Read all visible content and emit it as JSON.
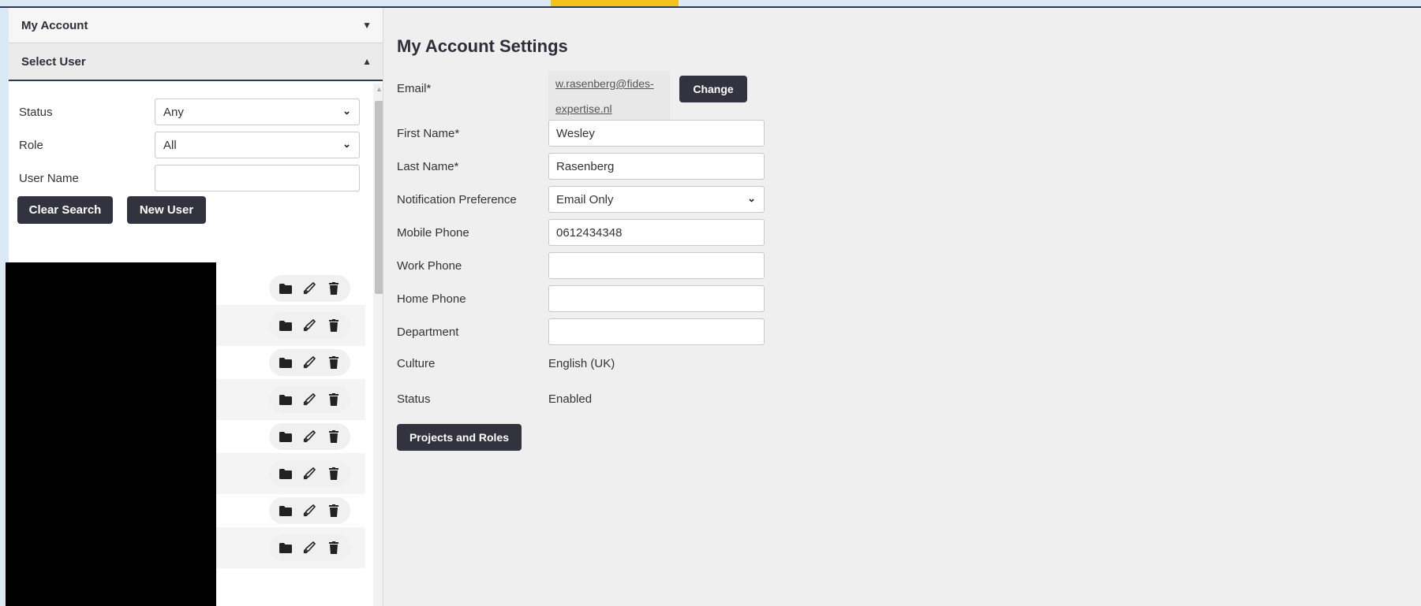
{
  "left_panel": {
    "my_account_header": "My Account",
    "select_user_header": "Select User",
    "filters": {
      "status_label": "Status",
      "status_value": "Any",
      "role_label": "Role",
      "role_value": "All",
      "username_label": "User Name",
      "username_value": ""
    },
    "buttons": {
      "clear_search": "Clear Search",
      "new_user": "New User"
    },
    "user_rows_count": 8,
    "row_action_icons": [
      "folder-icon",
      "edit-icon",
      "trash-icon"
    ]
  },
  "main": {
    "title": "My Account Settings",
    "email_label": "Email*",
    "email_value": "w.rasenberg@fides-expertise.nl",
    "email_line1": "w.rasenberg@fides-",
    "email_line2": "expertise.nl",
    "change_button": "Change",
    "first_name_label": "First Name*",
    "first_name_value": "Wesley",
    "last_name_label": "Last Name*",
    "last_name_value": "Rasenberg",
    "notification_label": "Notification Preference",
    "notification_value": "Email Only",
    "mobile_label": "Mobile Phone",
    "mobile_value": "0612434348",
    "work_label": "Work Phone",
    "work_value": "",
    "home_label": "Home Phone",
    "home_value": "",
    "department_label": "Department",
    "department_value": "",
    "culture_label": "Culture",
    "culture_value": "English (UK)",
    "status_label": "Status",
    "status_value": "Enabled",
    "projects_button": "Projects and Roles"
  },
  "colors": {
    "accent": "#f2c318",
    "button_bg": "#33333f",
    "page_bg": "#dbe9f5"
  }
}
